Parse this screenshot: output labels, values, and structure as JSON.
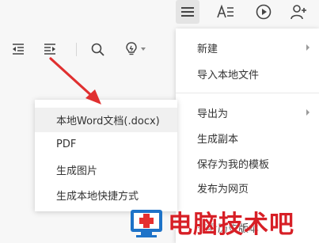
{
  "right_menu": {
    "items": [
      {
        "label": "新建",
        "has_submenu": true
      },
      {
        "label": "导入本地文件",
        "has_submenu": false
      },
      {
        "label": "导出为",
        "has_submenu": true
      },
      {
        "label": "生成副本",
        "has_submenu": false
      },
      {
        "label": "保存为我的模板",
        "has_submenu": false
      },
      {
        "label": "发布为网页",
        "has_submenu": false
      },
      {
        "label": "查看历史版本",
        "has_submenu": false
      }
    ]
  },
  "export_submenu": {
    "items": [
      {
        "label": "本地Word文档(.docx)"
      },
      {
        "label": "PDF"
      },
      {
        "label": "生成图片"
      },
      {
        "label": "生成本地快捷方式"
      }
    ]
  },
  "watermark": {
    "text": "电脑技术吧"
  },
  "colors": {
    "accent_red": "#e03030",
    "watermark_red": "#d71f26"
  }
}
